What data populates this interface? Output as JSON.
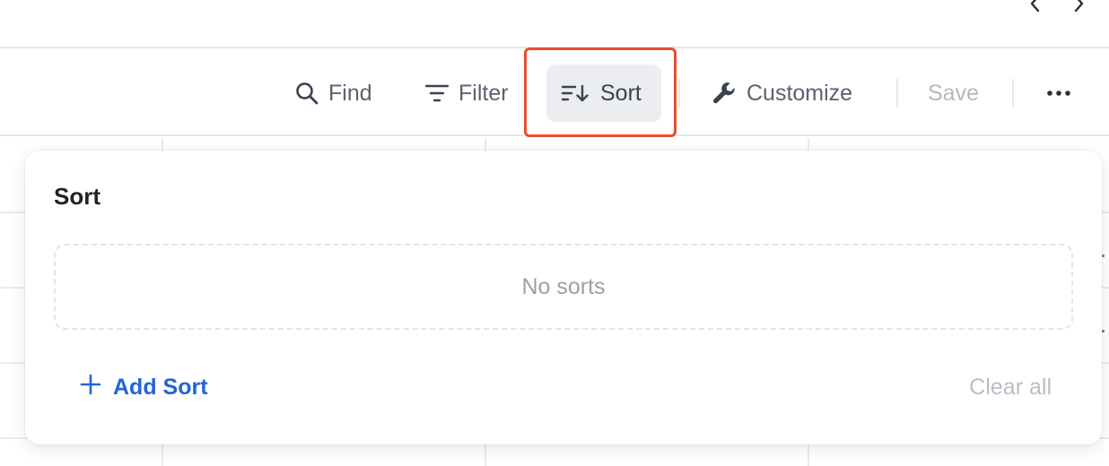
{
  "toolbar": {
    "find_label": "Find",
    "filter_label": "Filter",
    "sort_label": "Sort",
    "customize_label": "Customize",
    "save_label": "Save",
    "more_icon": "more-horizontal-icon"
  },
  "pagination": {
    "prev_icon": "chevron-left-icon",
    "next_icon": "chevron-right-icon"
  },
  "sort_popup": {
    "title": "Sort",
    "empty_message": "No sorts",
    "add_label": "Add Sort",
    "clear_label": "Clear all"
  },
  "colors": {
    "accent_blue": "#2563d6",
    "highlight_border": "#e4502f",
    "active_button_bg": "#ebedf0"
  }
}
